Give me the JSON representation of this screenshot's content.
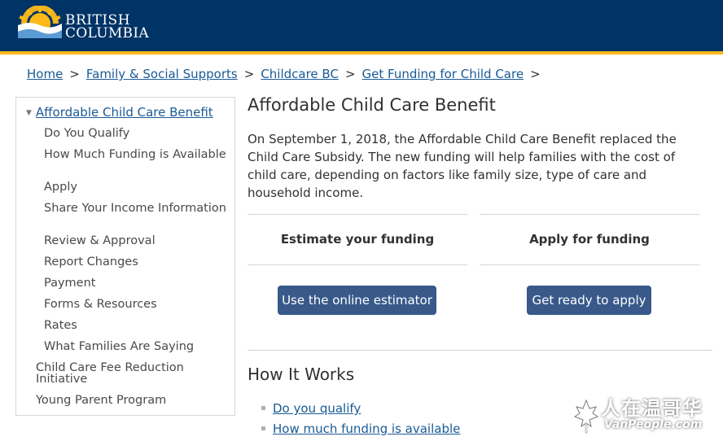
{
  "header": {
    "logo_line1": "BRITISH",
    "logo_line2": "COLUMBIA",
    "bg_color": "#003366",
    "accent_color": "#fcba19"
  },
  "breadcrumb": [
    "Home",
    "Family & Social Supports",
    "Childcare BC",
    "Get Funding for Child Care"
  ],
  "breadcrumb_sep": ">",
  "sidebar": {
    "current": "Affordable Child Care Benefit",
    "items": [
      "Do You Qualify",
      "How Much Funding is Available",
      "Apply",
      "Share Your Income Information",
      "Review & Approval",
      "Report Changes",
      "Payment",
      "Forms & Resources",
      "Rates",
      "What Families Are Saying"
    ],
    "siblings": [
      "Child Care Fee Reduction Initiative",
      "Young Parent Program"
    ]
  },
  "main": {
    "title": "Affordable Child Care Benefit",
    "intro": "On September 1, 2018, the Affordable Child Care Benefit replaced the Child Care Subsidy. The new funding will help families with the cost of child care, depending on factors like family size, type of care and household income.",
    "cards": [
      {
        "title": "Estimate your funding",
        "button": "Use the online estimator"
      },
      {
        "title": "Apply for funding",
        "button": "Get ready to apply"
      }
    ],
    "button_color": "#38598a",
    "section_title": "How It Works",
    "how_items": [
      "Do you qualify",
      "How much funding is available"
    ]
  },
  "watermark": {
    "text": "人在温哥华",
    "sub": "VanPeople.com"
  }
}
